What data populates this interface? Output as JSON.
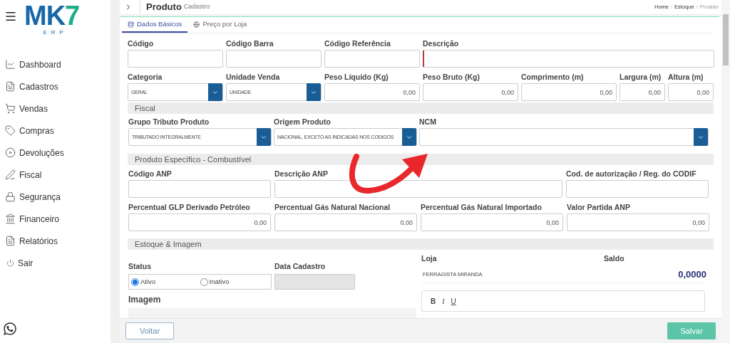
{
  "sidebar": {
    "logo": {
      "main": "MK",
      "accent": "7",
      "subtitle": "ERP"
    },
    "menu_items": [
      {
        "label": "Dashboard"
      },
      {
        "label": "Cadastros"
      },
      {
        "label": "Vendas"
      },
      {
        "label": "Compras"
      },
      {
        "label": "Devoluções"
      },
      {
        "label": "Fiscal"
      },
      {
        "label": "Segurança"
      },
      {
        "label": "Financeiro"
      },
      {
        "label": "Relatórios"
      },
      {
        "label": "Sair"
      }
    ]
  },
  "header": {
    "title": "Produto",
    "subtitle": "Cadastro",
    "breadcrumbs": [
      "Home",
      "Estoque",
      "Produto"
    ],
    "breadcrumb_separator": "/"
  },
  "tabs": [
    {
      "label": "Dados Básicos",
      "selected": true
    },
    {
      "label": "Preço por Loja",
      "selected": false
    }
  ],
  "basic_rows": [
    [
      {
        "label": "Código",
        "kind": "text",
        "required": false
      },
      {
        "label": "Código Barra",
        "kind": "text",
        "required": false
      },
      {
        "label": "Código Referência",
        "kind": "text",
        "required": false
      },
      {
        "label": "Descrição",
        "kind": "text",
        "required": true
      }
    ],
    [
      {
        "label": "Categoria",
        "kind": "select",
        "value": "GERAL",
        "required": false
      },
      {
        "label": "Unidade Venda",
        "kind": "select",
        "value": "UNIDADE",
        "required": false
      },
      {
        "label": "Peso Líquido (Kg)",
        "kind": "number",
        "value": "0,00",
        "required": false
      },
      {
        "label": "Peso Bruto (Kg)",
        "kind": "number",
        "value": "0,00",
        "required": false
      },
      {
        "label": "Comprimento (m)",
        "kind": "number",
        "value": "0,00",
        "required": false
      },
      {
        "label": "Largura (m)",
        "kind": "number",
        "value": "0,00",
        "required": false
      },
      {
        "label": "Altura (m)",
        "kind": "number",
        "value": "0,00",
        "required": false
      }
    ]
  ],
  "fiscal": {
    "title": "Fiscal",
    "fields": [
      {
        "label": "Grupo Tributo Produto",
        "kind": "select",
        "value": "TRIBUTADO INTEGRALMENTE"
      },
      {
        "label": "Origem Produto",
        "kind": "select",
        "value": "NACIONAL, EXCETO AS INDICADAS NOS CODIGOS"
      },
      {
        "label": "NCM",
        "kind": "select"
      }
    ]
  },
  "fuel": {
    "title": "Produto Específico - Combustível",
    "fields": [
      {
        "label": "Código ANP",
        "kind": "text"
      },
      {
        "label": "Descrição ANP",
        "kind": "text"
      },
      {
        "label": "Cod. de autorização / Reg. do CODIF",
        "kind": "text"
      },
      {
        "label": "Percentual GLP Derivado Petróleo",
        "kind": "number",
        "value": "0,00"
      },
      {
        "label": "Percentual Gás Natural Nacional",
        "kind": "number",
        "value": "0,00"
      },
      {
        "label": "Percentual Gás Natural Importado",
        "kind": "number",
        "value": "0,00"
      },
      {
        "label": "Valor Partida ANP",
        "kind": "number",
        "value": "0,00"
      }
    ]
  },
  "stock": {
    "title": "Estoque & Imagem",
    "status_label": "Status",
    "status_options": [
      {
        "label": "Ativo",
        "selected": true
      },
      {
        "label": "Inativo",
        "selected": false
      }
    ],
    "date_label": "Data Cadastro",
    "image_label": "Imagem",
    "store_column": "Loja",
    "balance_column": "Saldo",
    "stores": [
      {
        "name": "FERRAGISTA MIRANDA",
        "balance": "0,0000"
      }
    ],
    "editor_tools": [
      "B",
      "I",
      "U"
    ]
  },
  "footer": {
    "back": "Voltar",
    "save": "Salvar"
  }
}
